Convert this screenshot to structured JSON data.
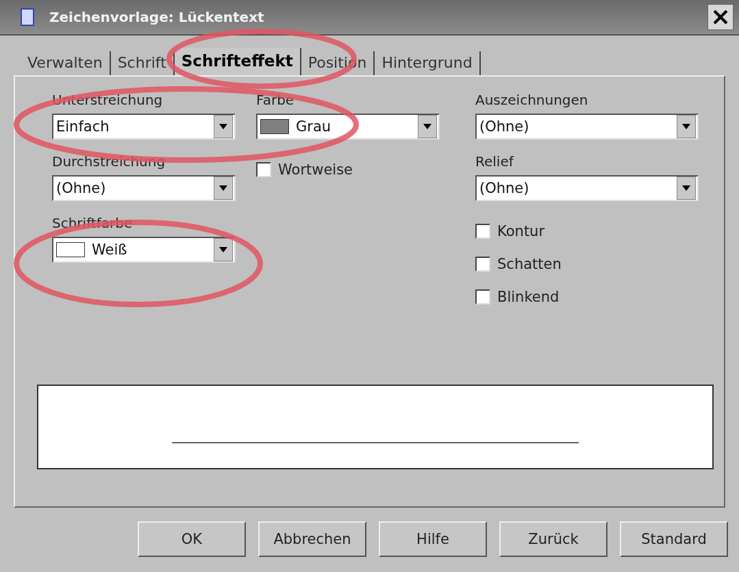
{
  "window": {
    "title": "Zeichenvorlage: Lückentext"
  },
  "tabs": [
    {
      "label": "Verwalten",
      "selected": false
    },
    {
      "label": "Schrift",
      "selected": false
    },
    {
      "label": "Schrifteffekt",
      "selected": true
    },
    {
      "label": "Position",
      "selected": false
    },
    {
      "label": "Hintergrund",
      "selected": false
    }
  ],
  "left_column": [
    {
      "kind": "dropdown",
      "label": "Unterstreichung",
      "value": "Einfach"
    },
    {
      "kind": "dropdown",
      "label": "Durchstreichung",
      "value": "(Ohne)"
    },
    {
      "kind": "dropdown",
      "label": "Schriftfarbe",
      "value": "Weiß",
      "color": "#ffffff"
    }
  ],
  "middle_column": [
    {
      "kind": "dropdown",
      "label": "Farbe",
      "value": "Grau",
      "color": "#808080"
    },
    {
      "kind": "checkbox",
      "label": "Wortweise",
      "checked": false
    }
  ],
  "right_column": [
    {
      "kind": "dropdown",
      "label": "Auszeichnungen",
      "value": "(Ohne)"
    },
    {
      "kind": "dropdown",
      "label": "Relief",
      "value": "(Ohne)"
    },
    {
      "kind": "checkbox",
      "label": "Kontur",
      "checked": false
    },
    {
      "kind": "checkbox",
      "label": "Schatten",
      "checked": false
    },
    {
      "kind": "checkbox",
      "label": "Blinkend",
      "checked": false
    }
  ],
  "preview": {
    "underline": true
  },
  "buttons": [
    "OK",
    "Abbrechen",
    "Hilfe",
    "Zurück",
    "Standard"
  ]
}
